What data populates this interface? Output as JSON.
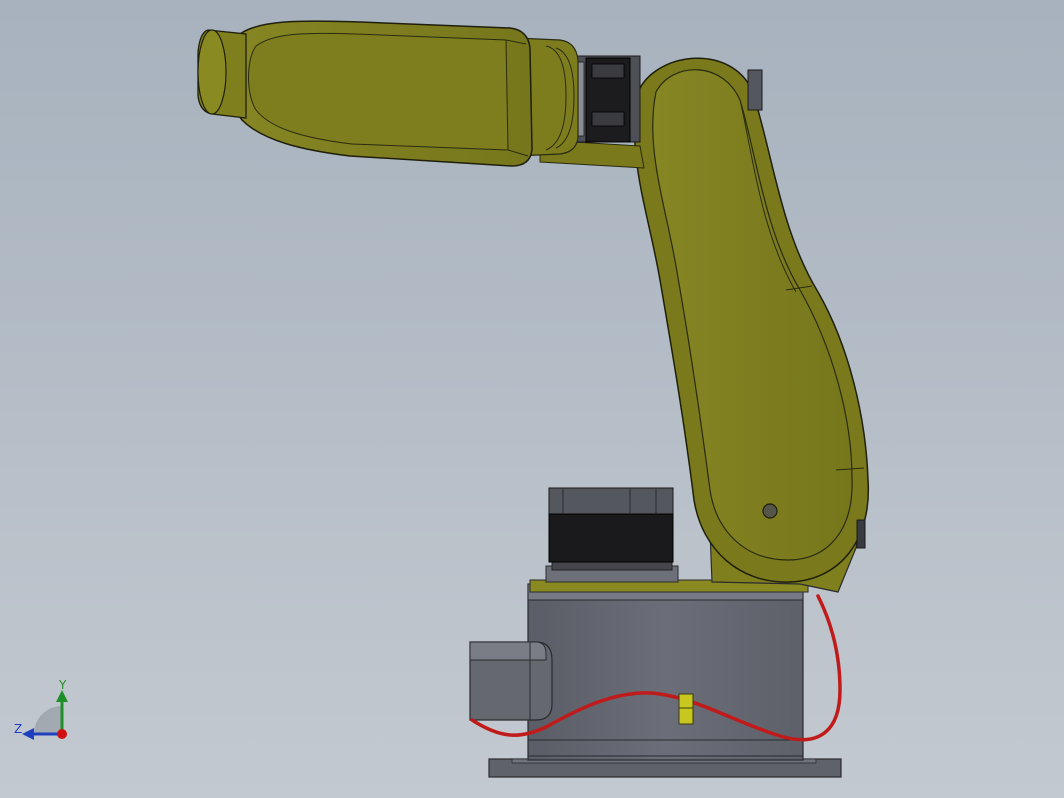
{
  "view": {
    "background_top": "#a7b2be",
    "background_bottom": "#c3c9d0"
  },
  "model": {
    "arm_color": "#7f7f1e",
    "arm_highlight": "#9e9e2a",
    "arm_dark": "#5f5f12",
    "base_color": "#63666f",
    "base_dark": "#4a4c53",
    "motor_color": "#1a1a1c",
    "cable_color": "#c01a1a",
    "clip_color": "#c7c720"
  },
  "triad": {
    "y_label": "Y",
    "z_label": "Z",
    "y_color": "#1f8f2a",
    "z_color": "#1f3fc0",
    "x_color": "#d01010"
  }
}
